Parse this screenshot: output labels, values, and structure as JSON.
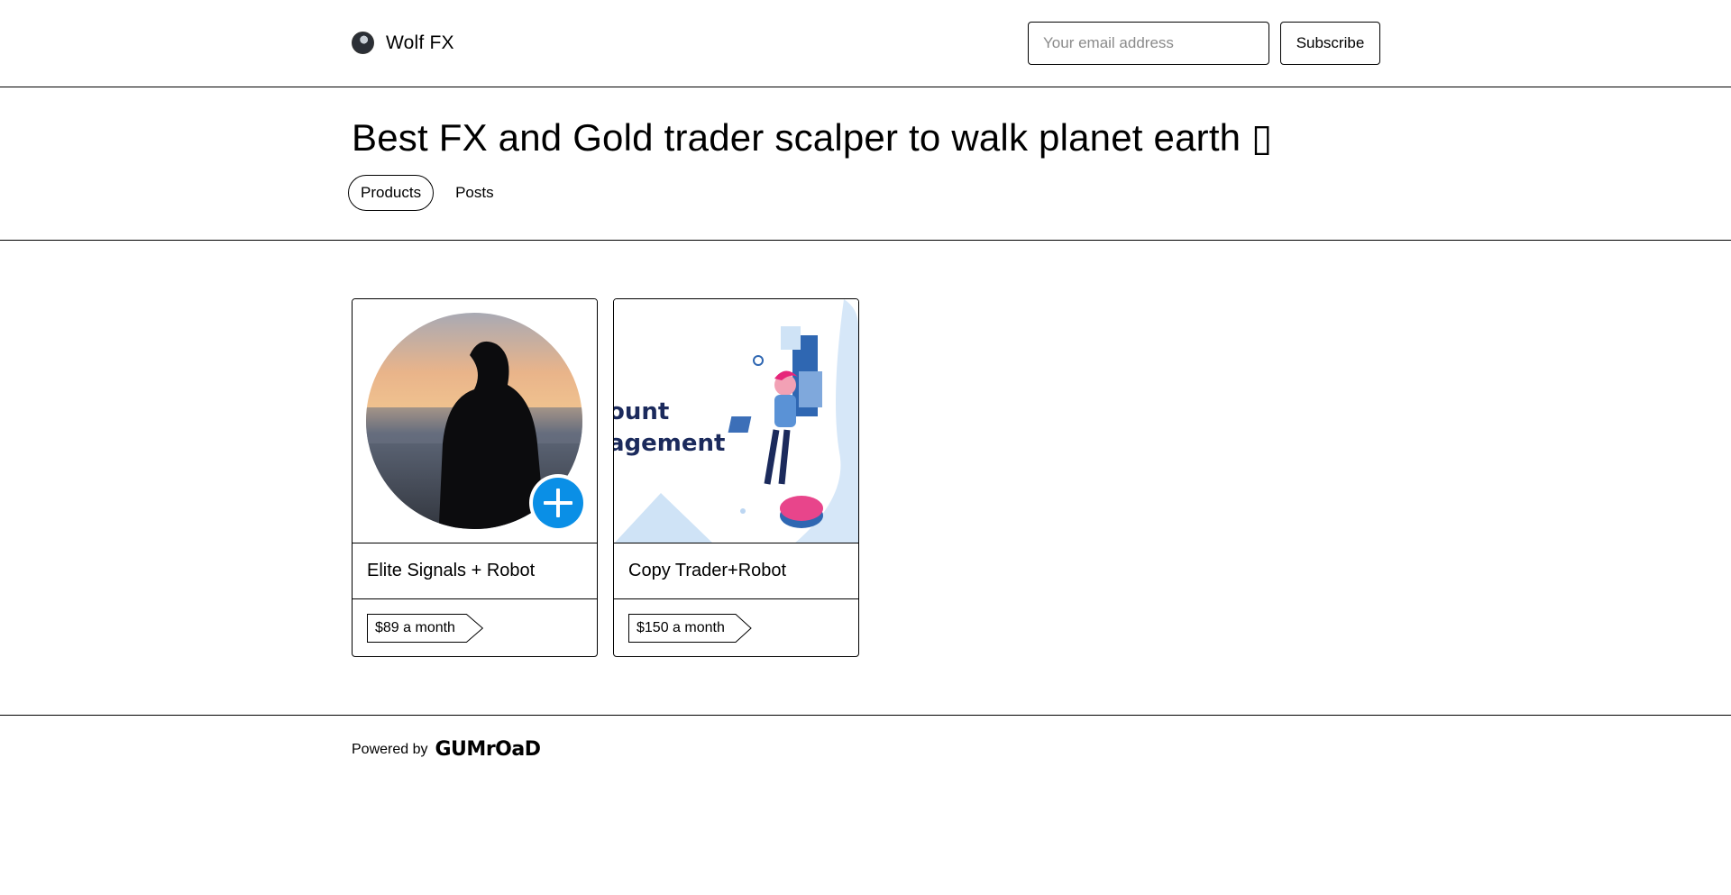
{
  "header": {
    "brand_name": "Wolf FX",
    "email_placeholder": "Your email address",
    "subscribe_label": "Subscribe"
  },
  "hero": {
    "title": "Best FX and Gold trader scalper to walk planet earth ▯",
    "tabs": [
      {
        "label": "Products",
        "active": true
      },
      {
        "label": "Posts",
        "active": false
      }
    ]
  },
  "products": [
    {
      "title": "Elite Signals + Robot",
      "price": "$89 a month"
    },
    {
      "title": "Copy Trader+Robot",
      "price": "$150 a month",
      "thumb_text": [
        "ount",
        "agement"
      ]
    }
  ],
  "footer": {
    "powered_by": "Powered by",
    "logo_text": "GUMrOaD"
  },
  "colors": {
    "border": "#000000",
    "accent_blue": "#0a8fe6",
    "navy": "#1b2a5c"
  }
}
